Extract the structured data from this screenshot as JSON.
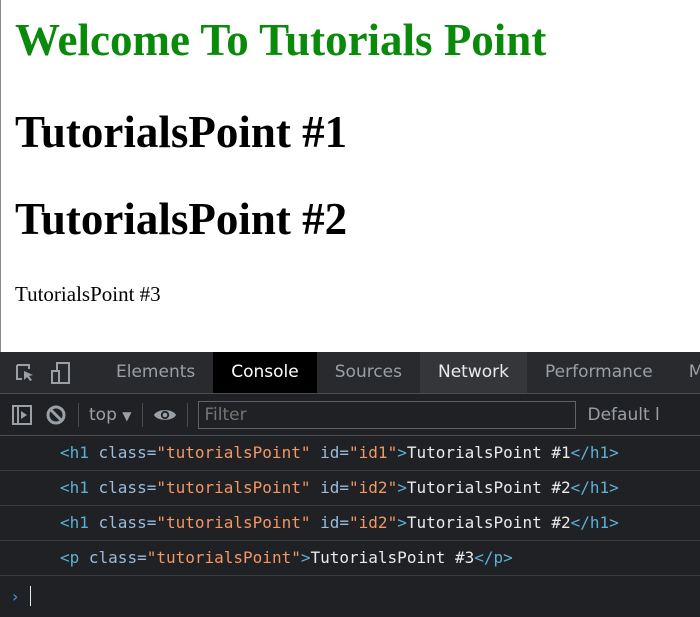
{
  "page": {
    "welcome": "Welcome To Tutorials Point",
    "h1_1": "TutorialsPoint #1",
    "h1_2": "TutorialsPoint #2",
    "p3": "TutorialsPoint #3"
  },
  "devtools": {
    "tabs": [
      "Elements",
      "Console",
      "Sources",
      "Network",
      "Performance",
      "Me"
    ],
    "active_tab": "Console",
    "context": "top",
    "filter_placeholder": "Filter",
    "levels": "Default l",
    "logs": [
      {
        "tag": "h1",
        "cls": "tutorialsPoint",
        "id": "id1",
        "text": "TutorialsPoint #1"
      },
      {
        "tag": "h1",
        "cls": "tutorialsPoint",
        "id": "id2",
        "text": "TutorialsPoint #2"
      },
      {
        "tag": "h1",
        "cls": "tutorialsPoint",
        "id": "id2",
        "text": "TutorialsPoint #2"
      },
      {
        "tag": "p",
        "cls": "tutorialsPoint",
        "text": "TutorialsPoint #3"
      }
    ]
  },
  "colors": {
    "green_heading": "#0a8a0a",
    "tag": "#5db0d7",
    "attr_value": "#f29766"
  }
}
